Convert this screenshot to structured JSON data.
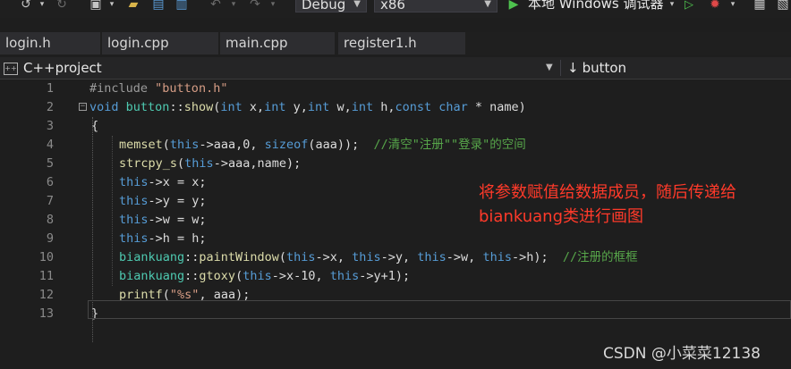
{
  "toolbar": {
    "config": "Debug",
    "platform": "x86",
    "run_label": "本地 Windows 调试器"
  },
  "tabs": [
    "login.h",
    "login.cpp",
    "main.cpp",
    "register1.h"
  ],
  "navbar": {
    "project": "C++project",
    "member": "button"
  },
  "editor": {
    "lines": [
      {
        "n": "1"
      },
      {
        "n": "2"
      },
      {
        "n": "3"
      },
      {
        "n": "4"
      },
      {
        "n": "5"
      },
      {
        "n": "6"
      },
      {
        "n": "7"
      },
      {
        "n": "8"
      },
      {
        "n": "9"
      },
      {
        "n": "10"
      },
      {
        "n": "11"
      },
      {
        "n": "12"
      },
      {
        "n": "13"
      }
    ],
    "code": {
      "l1_directive": "#include",
      "l1_file": "\"button.h\"",
      "l2_void": "void",
      "l2_class": "button",
      "l2_fn": "show",
      "l2_int1": "int",
      "l2_p1": " x,",
      "l2_int2": "int",
      "l2_p2": " y,",
      "l2_int3": "int",
      "l2_p3": " w,",
      "l2_int4": "int",
      "l2_p4": " h,",
      "l2_const": "const",
      "l2_char": "char",
      "l2_p5": " * name)",
      "l3": "{",
      "l4_fn": "memset",
      "l4_this": "this",
      "l4_rest1": "->aaa,0, ",
      "l4_sizeof": "sizeof",
      "l4_rest2": "(aaa));  ",
      "l4_comment": "//清空\"注册\"\"登录\"的空间",
      "l5_fn": "strcpy_s",
      "l5_this": "this",
      "l5_rest": "->aaa,name);",
      "l6_this": "this",
      "l6_rest": "->x = x;",
      "l7_this": "this",
      "l7_rest": "->y = y;",
      "l8_this": "this",
      "l8_rest": "->w = w;",
      "l9_this": "this",
      "l9_rest": "->h = h;",
      "l10_class": "biankuang",
      "l10_fn": "paintWindow",
      "l10_this1": "this",
      "l10_a1": "->x, ",
      "l10_this2": "this",
      "l10_a2": "->y, ",
      "l10_this3": "this",
      "l10_a3": "->w, ",
      "l10_this4": "this",
      "l10_a4": "->h);  ",
      "l10_comment": "//注册的框框",
      "l11_class": "biankuang",
      "l11_fn": "gtoxy",
      "l11_this1": "this",
      "l11_a1": "->x-10, ",
      "l11_this2": "this",
      "l11_a2": "->y+1);",
      "l12_fn": "printf",
      "l12_str": "\"%s\"",
      "l12_rest": ", aaa);",
      "l13": "}"
    }
  },
  "annotation": {
    "line1": "将参数赋值给数据成员，随后传递给",
    "line2": "biankuang类进行画图"
  },
  "watermark": "CSDN @小菜菜12138",
  "colors": {
    "keyword": "#569cd6",
    "function": "#dcdcaa",
    "string": "#d69d85",
    "comment": "#57a64a",
    "class": "#4ec9b0",
    "annotation": "#ff3a2a"
  }
}
